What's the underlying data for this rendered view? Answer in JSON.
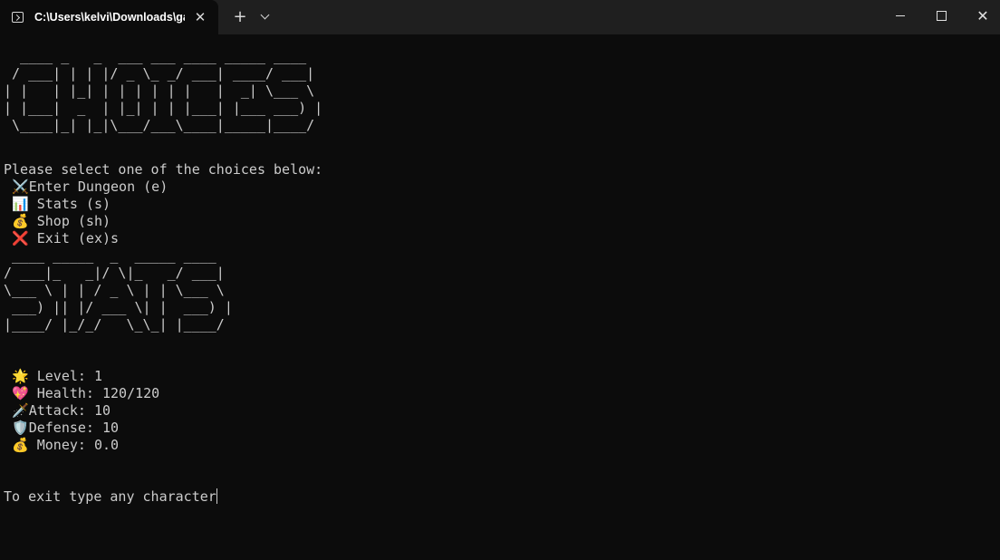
{
  "window": {
    "tab_title": "C:\\Users\\kelvi\\Downloads\\gar",
    "tab_close": "✕",
    "new_tab": "+",
    "close_glyph": "✕"
  },
  "terminal": {
    "choices_ascii": "  ____ _   _  ___ ___ ____ _____ ____\n / ___| | | |/ _ \\_ _/ ___| ____/ ___|\n| |   | |_| | | | | | |   |  _| \\___ \\\n| |___|  _  | |_| | | |___| |___ ___) |\n \\____|_| |_|\\___/___\\____|_____|____/",
    "prompt": "Please select one of the choices below:",
    "menu": [
      {
        "icon": "⚔️",
        "label": "Enter Dungeon (e)"
      },
      {
        "icon": "📊",
        "label": "Stats (s)"
      },
      {
        "icon": "💰",
        "label": "Shop (sh)"
      },
      {
        "icon": "❌",
        "label": "Exit (ex)s"
      }
    ],
    "stats_ascii": " ____ _____  _  _____ ____\n/ ___|_   _|/ \\|_   _/ ___|\n\\___ \\ | | / _ \\ | | \\___ \\\n ___) || |/ ___ \\| |  ___) |\n|____/ |_/_/   \\_\\_| |____/",
    "stats": [
      {
        "icon": "🌟",
        "label": "Level: 1"
      },
      {
        "icon": "💖",
        "label": "Health: 120/120"
      },
      {
        "icon": "🗡️",
        "label": "Attack: 10"
      },
      {
        "icon": "🛡️",
        "label": "Defense: 10"
      },
      {
        "icon": "💰",
        "label": "Money: 0.0"
      }
    ],
    "exit_prompt": "To exit type any character"
  }
}
